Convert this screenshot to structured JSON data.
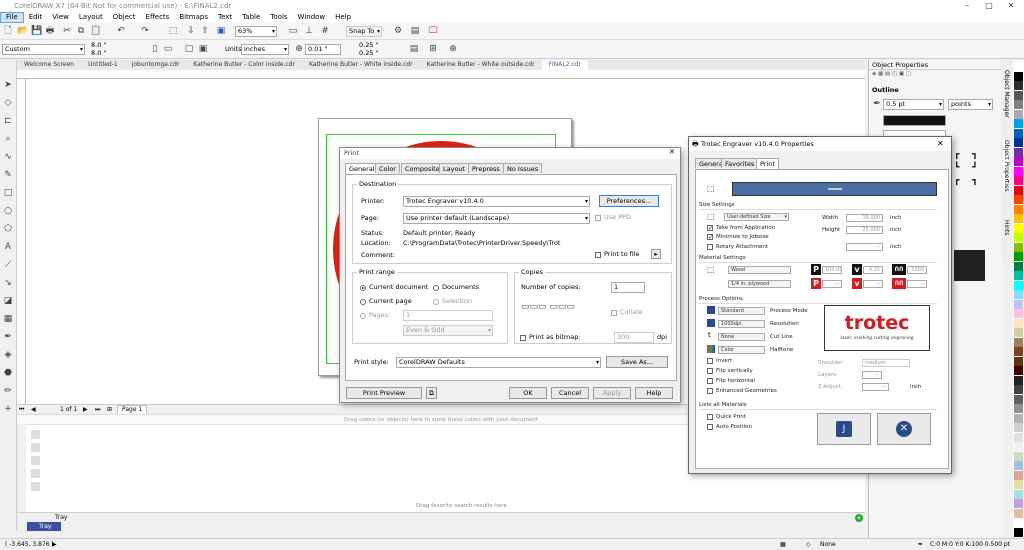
{
  "app": {
    "title": "CorelDRAW X7 (64-Bit Not for commercial use) - E:\\FINAL2.cdr",
    "menu": [
      "File",
      "Edit",
      "View",
      "Layout",
      "Object",
      "Effects",
      "Bitmaps",
      "Text",
      "Table",
      "Tools",
      "Window",
      "Help"
    ]
  },
  "toolbar1": {
    "zoom": "63%",
    "snap": "Snap To"
  },
  "propbar": {
    "preset": "Custom",
    "width": "8.0 \"",
    "height": "8.0 \"",
    "units_label": "Units:",
    "units": "inches",
    "nudge": "0.01 \"",
    "dup_x": "0.25 \"",
    "dup_y": "0.25 \""
  },
  "doc_tabs": [
    "Welcome Screen",
    "Untitled-1",
    "jobuntomga.cdr",
    "Katherine Butler - Color inside.cdr",
    "Katherine Butler - White inside.cdr",
    "Katherine Butler - White outside.cdr",
    "FINAL2.cdr"
  ],
  "pagebar": {
    "pageinfo": "1 of 1",
    "page": "Page 1"
  },
  "colorbar_hint": "Drag colors (or objects) here to store these colors with your document",
  "tray": {
    "hint": "Drag favorite search results here",
    "tab": "Tray",
    "label": "Tray"
  },
  "status": {
    "coords": "( -3.645, 3.876 )",
    "fill": "None",
    "outline": "C:0 M:0 Y:0 K:100  0.500 pt"
  },
  "objprops": {
    "title": "Object Properties",
    "section": "Outline",
    "width": "0.5 pt",
    "units": "points"
  },
  "sidetabs": [
    "Object Manager",
    "Object Properties",
    "Hints"
  ],
  "palette_colors": [
    "#ffffff",
    "#000000",
    "#2b2b2b",
    "#555555",
    "#808080",
    "#aaaaaa",
    "#00a0e9",
    "#0060c0",
    "#003399",
    "#7030a0",
    "#c000c0",
    "#ff00ff",
    "#ff0080",
    "#e60012",
    "#ff4000",
    "#ff8000",
    "#ffc000",
    "#ffff00",
    "#c0ff00",
    "#80c000",
    "#00a000",
    "#008040",
    "#00c0a0",
    "#00ffff",
    "#80e0ff",
    "#c0c0ff",
    "#ffc0e0",
    "#ffe0c0",
    "#d0d0a0",
    "#a08060",
    "#804020",
    "#603010",
    "#400000",
    "#202020",
    "#404040",
    "#606060",
    "#909090",
    "#b0b0b0",
    "#d0d0d0",
    "#e0e0e0",
    "#f0f0f0",
    "#c0e0c0",
    "#a0c0e0",
    "#e0a0a0",
    "#e0e0a0",
    "#a0e0e0",
    "#c0a0e0",
    "#e0c0a0",
    "#ffffff",
    "#000000"
  ],
  "print_dialog": {
    "title": "Print",
    "tabs": [
      "General",
      "Color",
      "Composite",
      "Layout",
      "Prepress",
      "No Issues"
    ],
    "destination_label": "Destination",
    "printer_label": "Printer:",
    "printer": "Trotec Engraver v10.4.0",
    "preferences": "Preferences...",
    "page_label": "Page:",
    "page": "Use printer default (Landscape)",
    "use_ppd": "Use PPD",
    "status_label": "Status:",
    "status": "Default printer; Ready",
    "location_label": "Location:",
    "location": "C:\\ProgramData\\Trotec\\PrinterDriver.Speedy\\Trot",
    "comment_label": "Comment:",
    "print_to_file": "Print to file",
    "range_label": "Print range",
    "current_document": "Current document",
    "documents": "Documents",
    "current_page": "Current page",
    "selection": "Selection",
    "pages_label": "Pages:",
    "pages_value": "1",
    "even_odd": "Even & Odd",
    "copies_label": "Copies",
    "num_copies_label": "Number of copies:",
    "num_copies": "1",
    "collate": "Collate",
    "print_as_bitmap": "Print as bitmap:",
    "dpi_value": "300",
    "dpi": "dpi",
    "style_label": "Print style:",
    "style": "CorelDRAW Defaults",
    "save_as": "Save As...",
    "print_preview": "Print Preview",
    "ok": "OK",
    "cancel": "Cancel",
    "apply": "Apply",
    "help": "Help"
  },
  "trotec_dialog": {
    "title": "Trotec Engraver v10.4.0 Properties",
    "tabs": [
      "General",
      "Favorites",
      "Print"
    ],
    "size_settings": "Size Settings",
    "size_mode": "User-defined Size",
    "width_label": "Width",
    "width": "39.000",
    "height_label": "Height",
    "height": "25.000",
    "unit": "inch",
    "take_from_app": "Take from Application",
    "minimize": "Minimize to Jobsize",
    "rotary": "Rotary Attachment",
    "material_settings": "Material Settings",
    "material": "Wood",
    "submaterial": "1/4 in. plywood",
    "p_val": "100.00",
    "v_val": "0.15",
    "ppi_val": "1000",
    "process_options": "Process Options",
    "process_mode_value": "Standard",
    "process_mode": "Process Mode",
    "resolution_value": "1000dpi",
    "resolution": "Resolution",
    "cutline_value": "None",
    "cutline": "Cut Line",
    "halftone_value": "Color",
    "halftone": "Halftone",
    "invert": "Invert",
    "flip_v": "Flip vertically",
    "flip_h": "Flip horizontal",
    "enhanced": "Enhanced Geometries",
    "logo": "trotec",
    "logo_tag": "laser. marking cutting engraving",
    "shoulder_label": "Shoulder",
    "shoulder": "medium",
    "layers_label": "Layers",
    "zadjust_label": "Z-Adjust.",
    "lists_all": "Lists all Materials",
    "quick_print": "Quick Print",
    "auto_position": "Auto Position"
  },
  "colors": {
    "accent": "#3a6db5",
    "swatch_blue": "#4a6fa5",
    "circle": "#e21f10"
  }
}
